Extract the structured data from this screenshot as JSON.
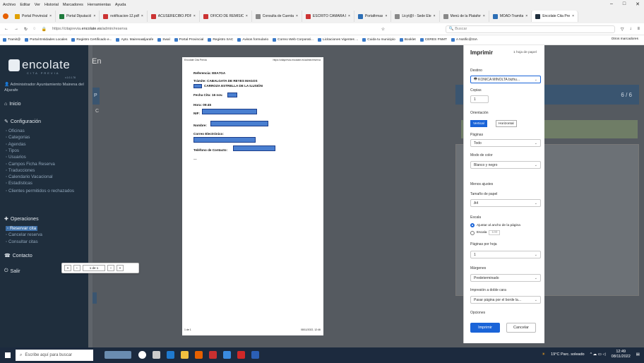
{
  "menu": [
    "Archivo",
    "Editar",
    "Ver",
    "Historial",
    "Marcadores",
    "Herramientas",
    "Ayuda"
  ],
  "tabs": [
    {
      "label": "Portal Provincial",
      "color": "#e0a000"
    },
    {
      "label": "Portal Diputació",
      "color": "#1e7a3c"
    },
    {
      "label": "notificacion-12.pdf",
      "color": "#c33"
    },
    {
      "label": "ACUSERECIBO.PDF",
      "color": "#c33"
    },
    {
      "label": "OFICIO DE REMISIÓ",
      "color": "#c33"
    },
    {
      "label": "Consulta de Cuenta",
      "color": "#888"
    },
    {
      "label": "ESCRITO CAMARA D",
      "color": "#c33"
    },
    {
      "label": "Portafirmas",
      "color": "#2c6eb5"
    },
    {
      "label": "Licyt@l - Sede Ele",
      "color": "#888"
    },
    {
      "label": "Menú de la Platafor",
      "color": "#888"
    },
    {
      "label": "MOAD-Tramita",
      "color": "#2c6eb5"
    },
    {
      "label": "Encolate Cita Pre",
      "color": "#1f2e3d",
      "active": true
    }
  ],
  "url": {
    "prefix": "https://citaprevia.",
    "domain": "encolate.es",
    "path": "/admin/reserva"
  },
  "search_placeholder": "Buscar",
  "bookmarks": [
    "Tramit@",
    "Portal Entidades Locales",
    "Registro Certificado e...",
    "Ayto. Mairena&ljarafe",
    "Swal",
    "Portal Provincial",
    "Registro SAC",
    "Avisos formulario",
    "Correo Web Corporati...",
    "Licitaciones Vigentes ...",
    "Cuida tu municipio",
    "Booklet",
    "CERES FNMT",
    "A Notific@SIA"
  ],
  "other_bookmarks": "Otros marcadores",
  "sidebar": {
    "logo_text": "encolate",
    "logo_sub": "CITA PREVIA",
    "version": "v.1.0.1.76",
    "admin": "Administrador Ayuntamiento Mairena del Aljarafe",
    "inicio": "Inicio",
    "configuracion": "Configuración",
    "config_items": [
      "Oficinas",
      "Categorias",
      "Agendas",
      "Tipos",
      "Usuarios",
      "Campos Ficha Reserva",
      "Traducciones",
      "Calendario Vacacional",
      "Estadísticas",
      "Clientes permitidos o rechazados"
    ],
    "operaciones": "Operaciones",
    "op_items": [
      "Reservar cita",
      "Cancelar reserva",
      "Consultar citas"
    ],
    "contacto": "Contacto",
    "salir": "Salir"
  },
  "main": {
    "crumb": "En",
    "step": "6 / 6",
    "side_letter_p": "P",
    "side_letter_c": "C"
  },
  "print_page": {
    "header": "Encolate Cita Previa",
    "url": "https://citaprevia.encolate.es/admin/reserva",
    "referencia": "Referencia: EEA7GA",
    "tramite": "Trámite: CABALGATA DE REYES MAGOS",
    "carroza": "CARROZA ESTRELLA DE LA ILUSIÓN",
    "fecha": "Fecha Cita: 16 nov.",
    "hora": "Hora: 09:45",
    "nif": "NIF:",
    "nombre": "Nombre:",
    "correo": "Correo Electrónico:",
    "telefono": "Teléfono de Contacto:",
    "dash": "—",
    "footer_left": "1 de 1",
    "footer_right": "08/11/2022, 12:46",
    "pager": "1 de 1"
  },
  "dialog": {
    "title": "Imprimir",
    "sheets": "1 hoja de papel",
    "destino_label": "Destino",
    "destino": "KONICA MINOLTA bizhu...",
    "copias_label": "Copias",
    "copias": "1",
    "orientacion_label": "Orientación",
    "vertical": "Vertical",
    "horizontal": "Horizontal",
    "paginas_label": "Páginas",
    "paginas": "Todo",
    "color_label": "Modo de color",
    "color": "Blanco y negro",
    "menos": "Menos ajustes",
    "papel_label": "Tamaño de papel",
    "papel": "A4",
    "escala_label": "Escala",
    "ajustar": "Ajustar al ancho de la página",
    "escala_opt": "Escala",
    "escala_val": "100",
    "pph_label": "Páginas por hoja",
    "pph": "1",
    "margenes_label": "Márgenes",
    "margenes": "Predeterminado",
    "doble_label": "Impresión a doble cara",
    "doble": "Pasar página por el borde la...",
    "opciones_label": "Opciones",
    "print_btn": "Imprimir",
    "cancel_btn": "Cancelar"
  },
  "taskbar": {
    "search": "Escribe aquí para buscar",
    "weather": "19°C Parc. soleado",
    "time": "12:49",
    "date": "08/11/2022"
  }
}
